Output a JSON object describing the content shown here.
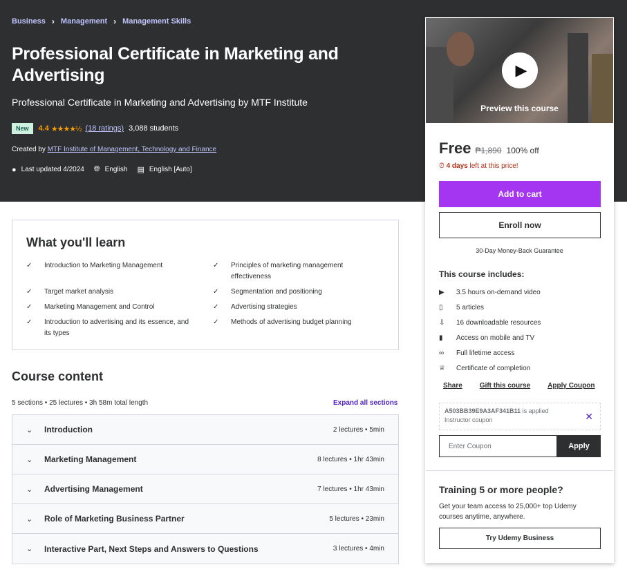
{
  "breadcrumb": [
    "Business",
    "Management",
    "Management Skills"
  ],
  "course": {
    "title": "Professional Certificate in Marketing and Advertising",
    "subtitle": "Professional Certificate in Marketing and Advertising by MTF Institute",
    "badge": "New",
    "rating": "4.4",
    "stars": "★★★★½",
    "ratings_count": "(18 ratings)",
    "students": "3,088 students",
    "created_prefix": "Created by",
    "author": "MTF Institute of Management, Technology and Finance",
    "last_updated": "Last updated 4/2024",
    "language": "English",
    "captions": "English [Auto]"
  },
  "learn": {
    "title": "What you'll learn",
    "items": [
      "Introduction to Marketing Management",
      "Principles of marketing management effectiveness",
      "Target market analysis",
      "Segmentation and positioning",
      "Marketing Management and Control",
      "Advertising strategies",
      "Introduction to advertising and its essence, and its types",
      "Methods of advertising budget planning"
    ]
  },
  "content": {
    "title": "Course content",
    "meta": "5 sections • 25 lectures • 3h 58m total length",
    "expand_label": "Expand all sections",
    "sections": [
      {
        "name": "Introduction",
        "info": "2 lectures • 5min"
      },
      {
        "name": "Marketing Management",
        "info": "8 lectures • 1hr 43min"
      },
      {
        "name": "Advertising Management",
        "info": "7 lectures • 1hr 43min"
      },
      {
        "name": "Role of Marketing Business Partner",
        "info": "5 lectures • 23min"
      },
      {
        "name": "Interactive Part, Next Steps and Answers to Questions",
        "info": "3 lectures • 4min"
      }
    ]
  },
  "sidebar": {
    "preview_label": "Preview this course",
    "price": "Free",
    "old_price": "₱1,890",
    "discount": "100% off",
    "timer_bold": "4 days",
    "timer_rest": "left at this price!",
    "add_to_cart": "Add to cart",
    "enroll": "Enroll now",
    "guarantee": "30-Day Money-Back Guarantee",
    "includes_title": "This course includes:",
    "includes": [
      {
        "icon": "video-icon",
        "text": "3.5 hours on-demand video"
      },
      {
        "icon": "article-icon",
        "text": "5 articles"
      },
      {
        "icon": "download-icon",
        "text": "16 downloadable resources"
      },
      {
        "icon": "mobile-icon",
        "text": "Access on mobile and TV"
      },
      {
        "icon": "infinity-icon",
        "text": "Full lifetime access"
      },
      {
        "icon": "trophy-icon",
        "text": "Certificate of completion"
      }
    ],
    "share": "Share",
    "gift": "Gift this course",
    "apply_coupon": "Apply Coupon",
    "coupon_code": "A503BB39E9A3AF341B11",
    "coupon_applied": "is applied",
    "coupon_type": "Instructor coupon",
    "coupon_placeholder": "Enter Coupon",
    "apply_button": "Apply",
    "training_title": "Training 5 or more people?",
    "training_text": "Get your team access to 25,000+ top Udemy courses anytime, anywhere.",
    "business_button": "Try Udemy Business"
  },
  "colors": {
    "header_bg": "#2d2f31",
    "accent_purple": "#a435f0",
    "link_lavender": "#c0c4fc",
    "star_orange": "#f69c08",
    "timer_red": "#b32d0f"
  }
}
